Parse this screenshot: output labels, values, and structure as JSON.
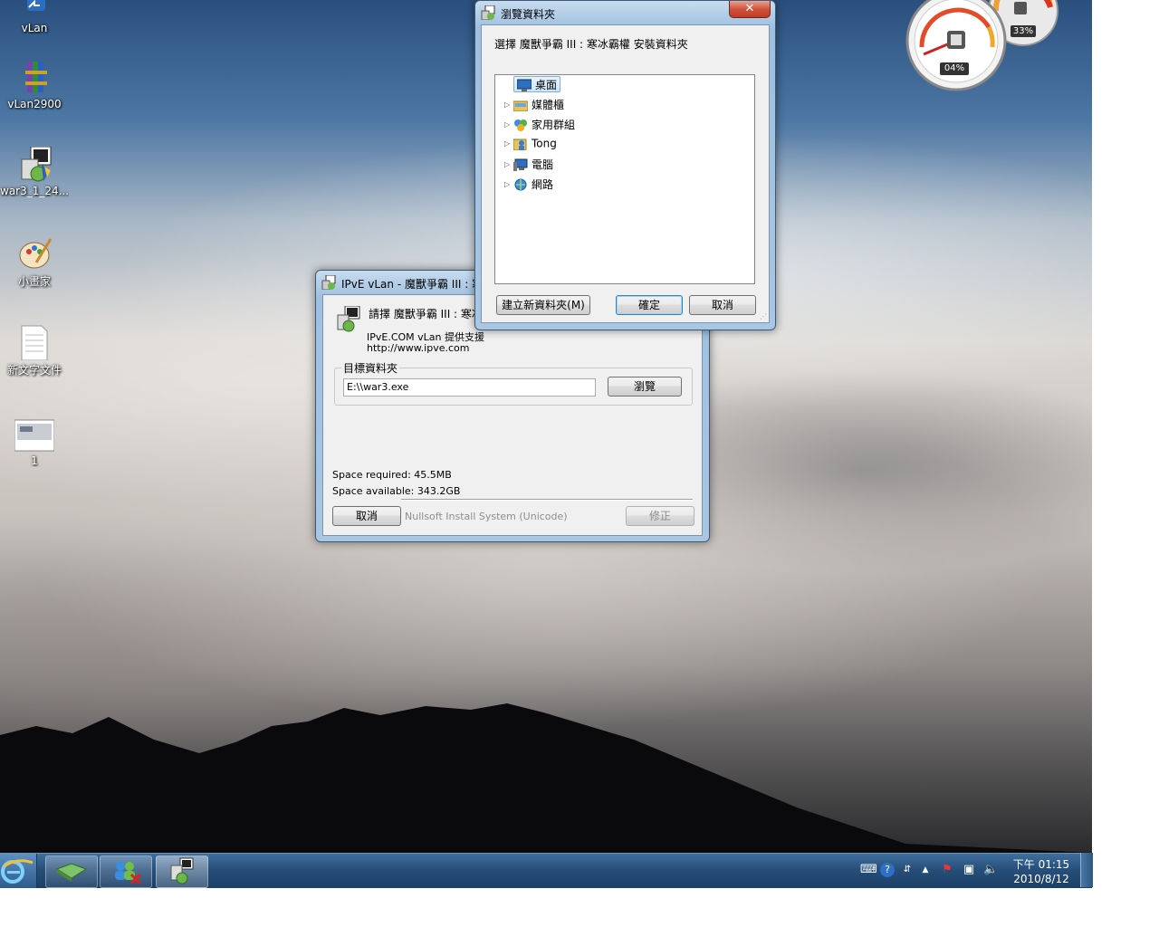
{
  "desktop_icons": [
    {
      "label": "vLan",
      "icon": "vlan-shortcut-icon"
    },
    {
      "label": "vLan2900",
      "icon": "winrar-archive-icon"
    },
    {
      "label": "war3_1_24...",
      "icon": "installer-icon"
    },
    {
      "label": "小畫家",
      "icon": "paint-icon"
    },
    {
      "label": "新文字文件",
      "icon": "text-document-icon"
    },
    {
      "label": "1",
      "icon": "image-file-icon"
    }
  ],
  "gadget": {
    "cpu": "04%",
    "memory": "33%"
  },
  "installer": {
    "title": "IPvE vLan - 魔獸爭霸 III : 寒",
    "heading": "請擇 魔獸爭霸 III : 寒冰",
    "line1": "IPvE.COM vLan 提供支援",
    "line2": "http://www.ipve.com",
    "group_label": "目標資料夾",
    "path_value": "E:\\\\war3.exe",
    "browse_label": "瀏覽",
    "space_required": "Space required: 45.5MB",
    "space_available": "Space available: 343.2GB",
    "cancel_label": "取消",
    "nsis_label": "Nullsoft Install System (Unicode)",
    "repair_label": "修正"
  },
  "browse_dialog": {
    "title": "瀏覽資料夾",
    "prompt": "選擇 魔獸爭霸 III : 寒冰霸權 安裝資料夾",
    "tree": [
      {
        "label": "桌面",
        "icon": "desktop-icon",
        "selected": true
      },
      {
        "label": "媒體櫃",
        "icon": "libraries-icon"
      },
      {
        "label": "家用群組",
        "icon": "homegroup-icon"
      },
      {
        "label": "Tong",
        "icon": "user-folder-icon"
      },
      {
        "label": "電腦",
        "icon": "computer-icon"
      },
      {
        "label": "網路",
        "icon": "network-icon"
      }
    ],
    "new_folder_label": "建立新資料夾(M)",
    "ok_label": "確定",
    "cancel_label": "取消",
    "close_label": "✕"
  },
  "taskbar": {
    "time": "下午 01:15",
    "date": "2010/8/12"
  }
}
